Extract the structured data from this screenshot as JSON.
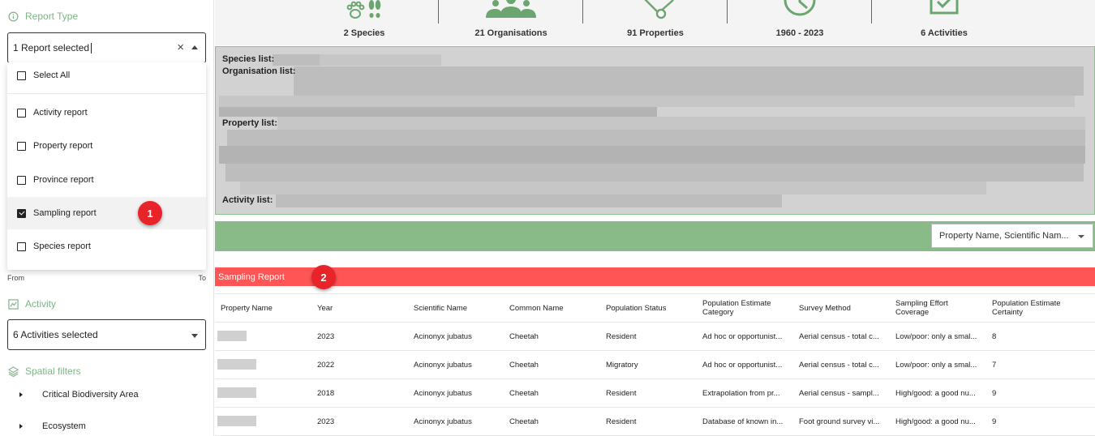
{
  "sidebar": {
    "report_type": {
      "title": "Report Type",
      "select_value": "1 Report selected",
      "options": [
        {
          "label": "Select All",
          "checked": false
        },
        {
          "label": "Activity report",
          "checked": false
        },
        {
          "label": "Property report",
          "checked": false
        },
        {
          "label": "Province report",
          "checked": false
        },
        {
          "label": "Sampling report",
          "checked": true
        },
        {
          "label": "Species report",
          "checked": false
        }
      ]
    },
    "range": {
      "from": "From",
      "to": "To"
    },
    "activity": {
      "title": "Activity",
      "select_value": "6 Activities selected"
    },
    "spatial": {
      "title": "Spatial filters",
      "items": [
        "Critical Biodiversity Area",
        "Ecosystem"
      ]
    }
  },
  "annotations": {
    "one": "1",
    "two": "2"
  },
  "stats": [
    {
      "label": "2 Species",
      "icon": "paw-icon"
    },
    {
      "label": "21 Organisations",
      "icon": "people-icon"
    },
    {
      "label": "91 Properties",
      "icon": "network-icon"
    },
    {
      "label": "1960 - 2023",
      "icon": "clock-icon"
    },
    {
      "label": "6 Activities",
      "icon": "checkbox-icon"
    }
  ],
  "lists": {
    "species": "Species list",
    "organisation": "Organisation list",
    "property": "Property list",
    "activity": "Activity list"
  },
  "sort": {
    "value": "Property Name, Scientific Nam..."
  },
  "report": {
    "title": "Sampling Report",
    "columns": [
      "Property Name",
      "Year",
      "Scientific Name",
      "Common Name",
      "Population Status",
      "Population Estimate Category",
      "Survey Method",
      "Sampling Effort Coverage",
      "Population Estimate Certainty"
    ],
    "rows": [
      {
        "year": "2023",
        "scientific": "Acinonyx jubatus",
        "common": "Cheetah",
        "status": "Resident",
        "category": "Ad hoc or opportunist...",
        "method": "Aerial census - total c...",
        "effort": "Low/poor: only a smal...",
        "certainty": "8"
      },
      {
        "year": "2022",
        "scientific": "Acinonyx jubatus",
        "common": "Cheetah",
        "status": "Migratory",
        "category": "Ad hoc or opportunist...",
        "method": "Aerial census - total c...",
        "effort": "Low/poor: only a smal...",
        "certainty": "7"
      },
      {
        "year": "2018",
        "scientific": "Acinonyx jubatus",
        "common": "Cheetah",
        "status": "Resident",
        "category": "Extrapolation from pr...",
        "method": "Aerial census - sampl...",
        "effort": "High/good: a good nu...",
        "certainty": "9"
      },
      {
        "year": "2023",
        "scientific": "Acinonyx jubatus",
        "common": "Cheetah",
        "status": "Resident",
        "category": "Database of known in...",
        "method": "Foot ground survey vi...",
        "effort": "High/good: a good nu...",
        "certainty": "9"
      }
    ]
  },
  "colors": {
    "accent_green": "#88bb88",
    "report_red": "#ff5555",
    "badge_red": "#e8232a",
    "icon_green": "#6ba56f"
  }
}
